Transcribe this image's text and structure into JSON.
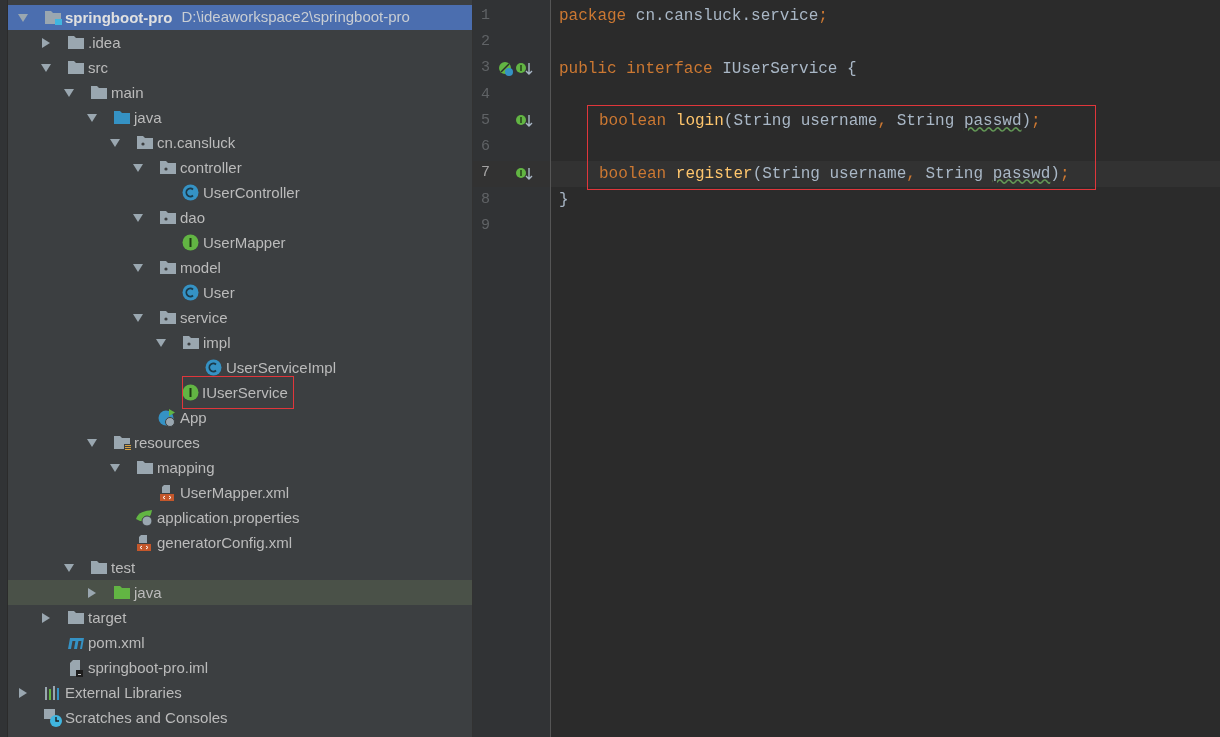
{
  "project_tree": {
    "items": [
      {
        "label": "springboot-pro",
        "path": "D:\\ideaworkspace2\\springboot-pro",
        "kind": "module",
        "expanded": true,
        "selected": true,
        "highlighted": false,
        "boxed": false,
        "children": [
          {
            "label": ".idea",
            "kind": "folder",
            "expanded": false,
            "selected": false,
            "highlighted": false,
            "boxed": false
          },
          {
            "label": "src",
            "kind": "folder",
            "expanded": true,
            "selected": false,
            "highlighted": false,
            "boxed": false,
            "children": [
              {
                "label": "main",
                "kind": "folder",
                "expanded": true,
                "selected": false,
                "highlighted": false,
                "boxed": false,
                "children": [
                  {
                    "label": "java",
                    "kind": "source-folder",
                    "expanded": true,
                    "selected": false,
                    "highlighted": false,
                    "boxed": false,
                    "children": [
                      {
                        "label": "cn.cansluck",
                        "kind": "package",
                        "expanded": true,
                        "selected": false,
                        "highlighted": false,
                        "boxed": false,
                        "children": [
                          {
                            "label": "controller",
                            "kind": "package",
                            "expanded": true,
                            "selected": false,
                            "highlighted": false,
                            "boxed": false,
                            "children": [
                              {
                                "label": "UserController",
                                "kind": "class",
                                "selected": false,
                                "highlighted": false,
                                "boxed": false
                              }
                            ]
                          },
                          {
                            "label": "dao",
                            "kind": "package",
                            "expanded": true,
                            "selected": false,
                            "highlighted": false,
                            "boxed": false,
                            "children": [
                              {
                                "label": "UserMapper",
                                "kind": "interface",
                                "selected": false,
                                "highlighted": false,
                                "boxed": false
                              }
                            ]
                          },
                          {
                            "label": "model",
                            "kind": "package",
                            "expanded": true,
                            "selected": false,
                            "highlighted": false,
                            "boxed": false,
                            "children": [
                              {
                                "label": "User",
                                "kind": "class",
                                "selected": false,
                                "highlighted": false,
                                "boxed": false
                              }
                            ]
                          },
                          {
                            "label": "service",
                            "kind": "package",
                            "expanded": true,
                            "selected": false,
                            "highlighted": false,
                            "boxed": false,
                            "children": [
                              {
                                "label": "impl",
                                "kind": "package",
                                "expanded": true,
                                "selected": false,
                                "highlighted": false,
                                "boxed": false,
                                "children": [
                                  {
                                    "label": "UserServiceImpl",
                                    "kind": "class",
                                    "selected": false,
                                    "highlighted": false,
                                    "boxed": false
                                  }
                                ]
                              },
                              {
                                "label": "IUserService",
                                "kind": "interface",
                                "selected": false,
                                "highlighted": false,
                                "boxed": true
                              }
                            ]
                          },
                          {
                            "label": "App",
                            "kind": "app",
                            "selected": false,
                            "highlighted": false,
                            "boxed": false
                          }
                        ]
                      }
                    ]
                  },
                  {
                    "label": "resources",
                    "kind": "resources-folder",
                    "expanded": true,
                    "selected": false,
                    "highlighted": false,
                    "boxed": false,
                    "children": [
                      {
                        "label": "mapping",
                        "kind": "folder",
                        "expanded": true,
                        "selected": false,
                        "highlighted": false,
                        "boxed": false,
                        "children": [
                          {
                            "label": "UserMapper.xml",
                            "kind": "xml",
                            "selected": false,
                            "highlighted": false,
                            "boxed": false
                          }
                        ]
                      },
                      {
                        "label": "application.properties",
                        "kind": "properties",
                        "selected": false,
                        "highlighted": false,
                        "boxed": false
                      },
                      {
                        "label": "generatorConfig.xml",
                        "kind": "xml",
                        "selected": false,
                        "highlighted": false,
                        "boxed": false
                      }
                    ]
                  }
                ]
              },
              {
                "label": "test",
                "kind": "folder",
                "expanded": true,
                "selected": false,
                "highlighted": false,
                "boxed": false,
                "children": [
                  {
                    "label": "java",
                    "kind": "test-folder",
                    "expanded": false,
                    "selected": false,
                    "highlighted": true,
                    "boxed": false
                  }
                ]
              }
            ]
          },
          {
            "label": "target",
            "kind": "folder",
            "expanded": false,
            "selected": false,
            "highlighted": false,
            "boxed": false
          },
          {
            "label": "pom.xml",
            "kind": "maven",
            "selected": false,
            "highlighted": false,
            "boxed": false
          },
          {
            "label": "springboot-pro.iml",
            "kind": "iml",
            "selected": false,
            "highlighted": false,
            "boxed": false
          }
        ]
      },
      {
        "label": "External Libraries",
        "kind": "libraries",
        "expanded": false,
        "selected": false,
        "highlighted": false,
        "boxed": false
      },
      {
        "label": "Scratches and Consoles",
        "kind": "scratches",
        "selected": false,
        "highlighted": false,
        "boxed": false
      }
    ]
  },
  "editor": {
    "lines": [
      {
        "number": "1",
        "current": false,
        "boxed": false,
        "tokens": [
          {
            "text": "package ",
            "kind": "keyword"
          },
          {
            "text": "cn.cansluck.service",
            "kind": "plain"
          },
          {
            "text": ";",
            "kind": "punct"
          }
        ]
      },
      {
        "number": "2",
        "current": false,
        "boxed": false
      },
      {
        "number": "3",
        "current": false,
        "boxed": false,
        "gutter": [
          {
            "kind": "spring-bean"
          },
          {
            "kind": "implemented"
          }
        ],
        "tokens": [
          {
            "text": "public interface ",
            "kind": "keyword"
          },
          {
            "text": "IUserService {",
            "kind": "plain"
          }
        ],
        "children": [
          {
            "number": "4",
            "current": false,
            "boxed": false
          },
          {
            "number": "5",
            "current": false,
            "boxed": true,
            "gutter": [
              {
                "kind": "implemented"
              }
            ],
            "tokens": [
              {
                "text": "boolean ",
                "kind": "keyword"
              },
              {
                "text": "login",
                "kind": "method"
              },
              {
                "text": "(String username",
                "kind": "plain"
              },
              {
                "text": ", ",
                "kind": "punct"
              },
              {
                "text": "String ",
                "kind": "plain"
              },
              {
                "text": "passwd",
                "kind": "typo"
              },
              {
                "text": ")",
                "kind": "plain"
              },
              {
                "text": ";",
                "kind": "punct"
              }
            ]
          },
          {
            "number": "6",
            "current": false,
            "boxed": true
          },
          {
            "number": "7",
            "current": true,
            "boxed": true,
            "gutter": [
              {
                "kind": "implemented"
              }
            ],
            "tokens": [
              {
                "text": "boolean ",
                "kind": "keyword"
              },
              {
                "text": "register",
                "kind": "method"
              },
              {
                "text": "(String username",
                "kind": "plain"
              },
              {
                "text": ", ",
                "kind": "punct"
              },
              {
                "text": "String ",
                "kind": "plain"
              },
              {
                "text": "passwd",
                "kind": "typo"
              },
              {
                "text": ")",
                "kind": "plain"
              },
              {
                "text": ";",
                "kind": "punct"
              }
            ]
          }
        ]
      },
      {
        "number": "8",
        "current": false,
        "boxed": false,
        "tokens": [
          {
            "text": "}",
            "kind": "plain"
          }
        ]
      },
      {
        "number": "9",
        "current": false,
        "boxed": false
      }
    ]
  }
}
